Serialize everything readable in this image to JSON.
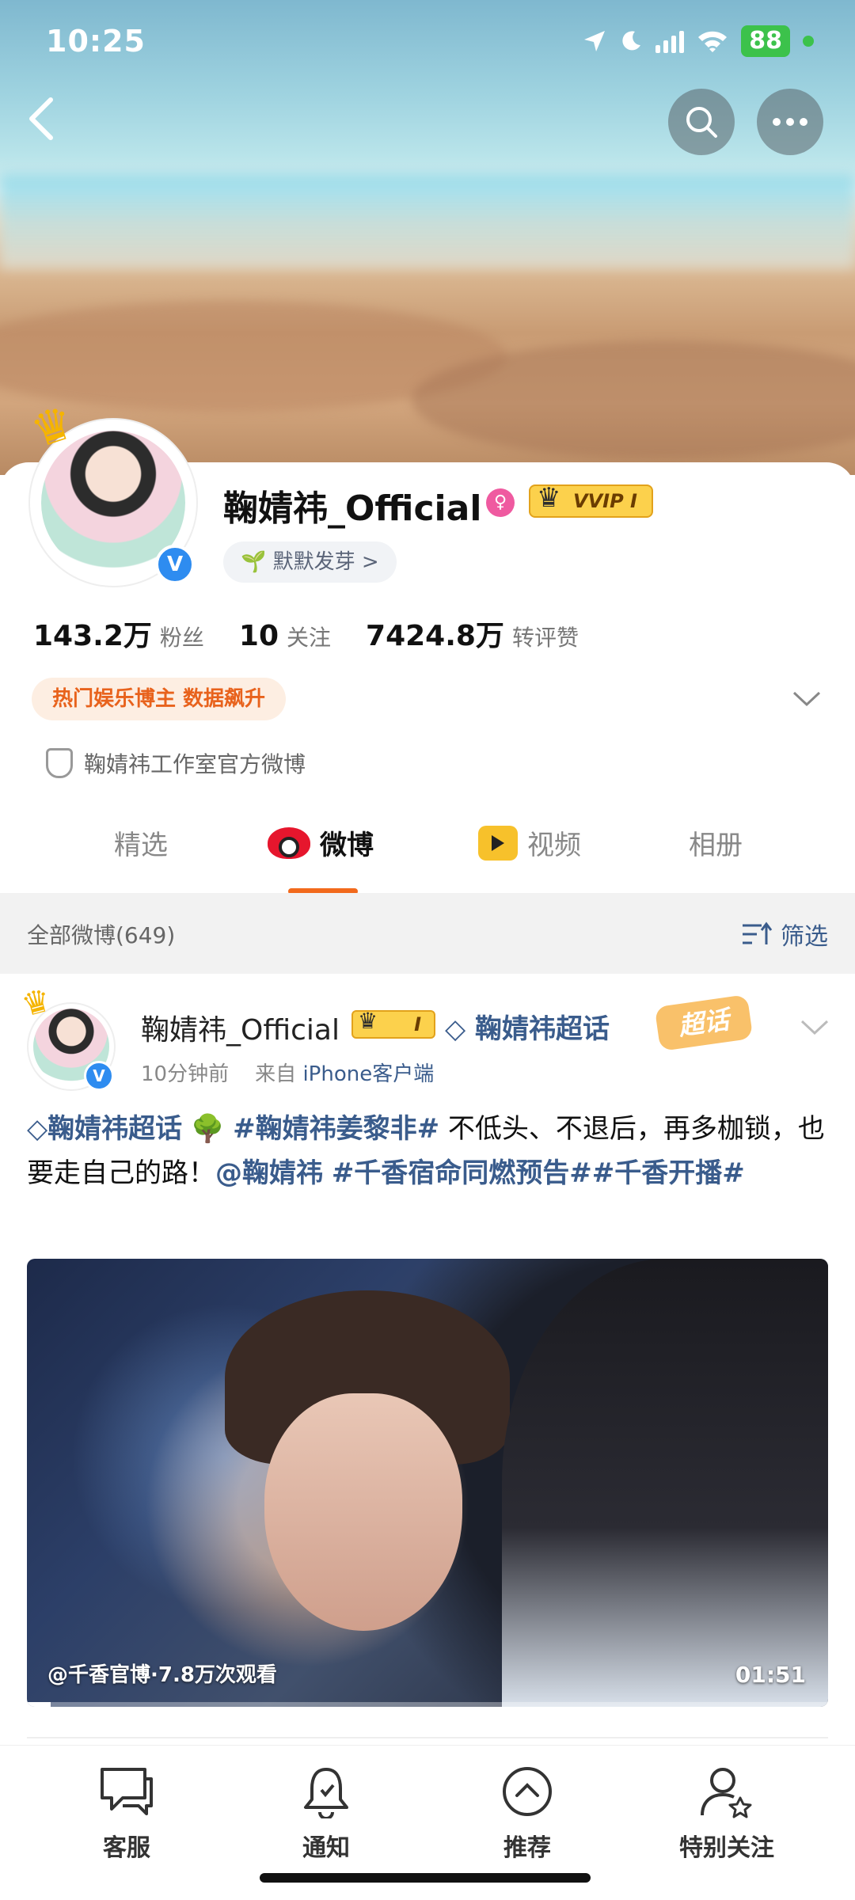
{
  "status_bar": {
    "time": "10:25",
    "battery": "88"
  },
  "profile": {
    "name": "鞠婧祎_Official",
    "vvip_label": "VVIP I",
    "sprout_label": "默默发芽 >",
    "stats": [
      {
        "value": "143.2万",
        "label": "粉丝"
      },
      {
        "value": "10",
        "label": "关注"
      },
      {
        "value": "7424.8万",
        "label": "转评赞"
      }
    ],
    "hot_tag": "热门娱乐博主  数据飙升",
    "studio_label": "鞠婧祎工作室官方微博"
  },
  "tabs": [
    {
      "label": "精选",
      "active": false
    },
    {
      "label": "微博",
      "active": true
    },
    {
      "label": "视频",
      "active": false
    },
    {
      "label": "相册",
      "active": false
    }
  ],
  "filter_bar": {
    "all_label": "全部微博(649)",
    "filter_label": "筛选"
  },
  "post": {
    "author": "鞠婧祎_Official",
    "vip_label": "I",
    "topic": "鞠婧祎超话",
    "chaohua_badge": "超话",
    "time": "10分钟前",
    "from_prefix": "来自",
    "source": "iPhone客户端",
    "text_parts": {
      "topic": "鞠婧祎超话",
      "tree": "🌳",
      "tag1": "#鞠婧祎姜黎非#",
      "body": " 不低头、不退后，再多枷锁，也要走自己的路！",
      "mention": "@鞠婧祎",
      "tag2": "#千香宿命同燃预告#",
      "tag3": "#千香开播#"
    },
    "video": {
      "caption": "@千香官博·7.8万次观看",
      "duration": "01:51",
      "progress": 0.03
    }
  },
  "bottom_bar": [
    {
      "label": "客服",
      "icon": "chat-icon"
    },
    {
      "label": "通知",
      "icon": "bell-icon"
    },
    {
      "label": "推荐",
      "icon": "up-circle-icon"
    },
    {
      "label": "特别关注",
      "icon": "user-star-icon"
    }
  ],
  "colors": {
    "accent": "#f26a1c",
    "link": "#3a5c8c",
    "verified": "#2e8cf0"
  }
}
